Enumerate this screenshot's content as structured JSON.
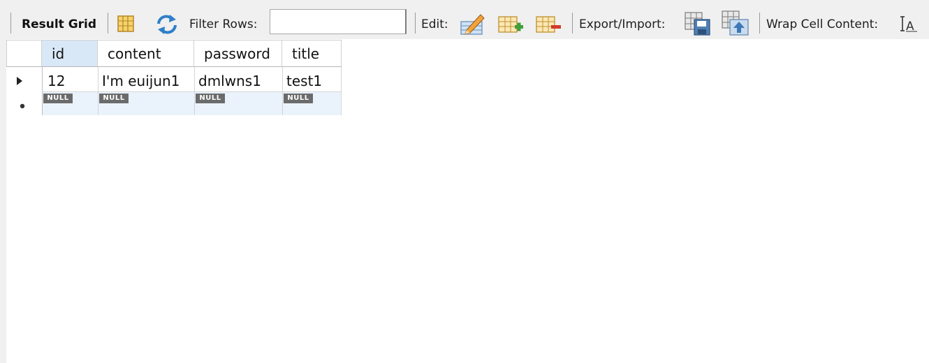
{
  "toolbar": {
    "result_grid_label": "Result Grid",
    "filter_rows_label": "Filter Rows:",
    "filter_rows_value": "",
    "edit_label": "Edit:",
    "export_import_label": "Export/Import:",
    "wrap_cell_label": "Wrap Cell Content:",
    "icons": [
      "grid-form-icon",
      "refresh-icon",
      "edit-row-icon",
      "add-row-icon",
      "delete-row-icon",
      "export-icon",
      "import-icon",
      "wrap-text-icon"
    ]
  },
  "grid": {
    "columns": [
      "id",
      "content",
      "password",
      "title"
    ],
    "rows": [
      {
        "id": "12",
        "content": "I'm euijun1",
        "password": "dmlwns1",
        "title": "test1"
      }
    ],
    "null_label": "NULL",
    "selected_column": "id"
  },
  "colors": {
    "toolbar_bg": "#f0f0f0",
    "selected_header": "#d9e8f7",
    "new_row_bg": "#eaf3fc",
    "null_badge": "#6b6b6b"
  }
}
